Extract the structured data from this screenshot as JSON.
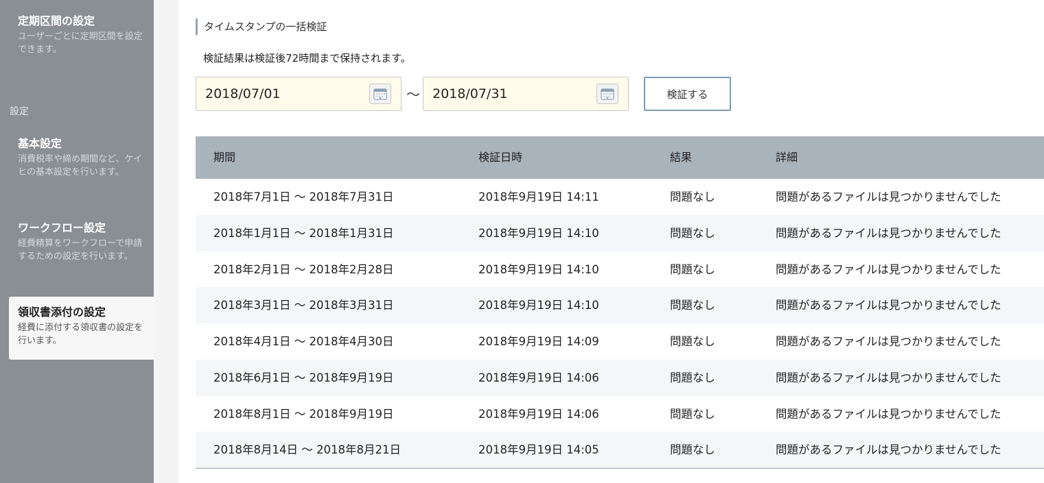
{
  "sidebar": {
    "items_top": [
      {
        "title": "定期区間の設定",
        "desc": "ユーザーごとに定期区間を設定できます。"
      }
    ],
    "section_label": "設定",
    "items": [
      {
        "title": "基本設定",
        "desc": "消費税率や締め期間など、ケイヒの基本設定を行います。"
      },
      {
        "title": "ワークフロー設定",
        "desc": "経費精算をワークフローで申請するための設定を行います。"
      },
      {
        "title": "領収書添付の設定",
        "desc": "経費に添付する領収書の設定を行います。"
      }
    ]
  },
  "main": {
    "heading": "タイムスタンプの一括検証",
    "note": "検証結果は検証後72時間まで保持されます。",
    "date_from": "2018/07/01",
    "date_to": "2018/07/31",
    "tilde": "〜",
    "verify_label": "検証する"
  },
  "table": {
    "headers": [
      "期間",
      "検証日時",
      "結果",
      "詳細"
    ],
    "rows": [
      [
        "2018年7月1日 〜 2018年7月31日",
        "2018年9月19日 14:11",
        "問題なし",
        "問題があるファイルは見つかりませんでした"
      ],
      [
        "2018年1月1日 〜 2018年1月31日",
        "2018年9月19日 14:10",
        "問題なし",
        "問題があるファイルは見つかりませんでした"
      ],
      [
        "2018年2月1日 〜 2018年2月28日",
        "2018年9月19日 14:10",
        "問題なし",
        "問題があるファイルは見つかりませんでした"
      ],
      [
        "2018年3月1日 〜 2018年3月31日",
        "2018年9月19日 14:10",
        "問題なし",
        "問題があるファイルは見つかりませんでした"
      ],
      [
        "2018年4月1日 〜 2018年4月30日",
        "2018年9月19日 14:09",
        "問題なし",
        "問題があるファイルは見つかりませんでした"
      ],
      [
        "2018年6月1日 〜 2018年9月19日",
        "2018年9月19日 14:06",
        "問題なし",
        "問題があるファイルは見つかりませんでした"
      ],
      [
        "2018年8月1日 〜 2018年9月19日",
        "2018年9月19日 14:06",
        "問題なし",
        "問題があるファイルは見つかりませんでした"
      ],
      [
        "2018年8月14日 〜 2018年8月21日",
        "2018年9月19日 14:05",
        "問題なし",
        "問題があるファイルは見つかりませんでした"
      ]
    ]
  },
  "icons": {
    "date_picker": "calendar-icon"
  },
  "colors": {
    "sidebar_bg": "#8a8f94",
    "table_header_bg": "#a9b3bc",
    "input_bg": "#fffceb",
    "button_border": "#7e9aae"
  }
}
